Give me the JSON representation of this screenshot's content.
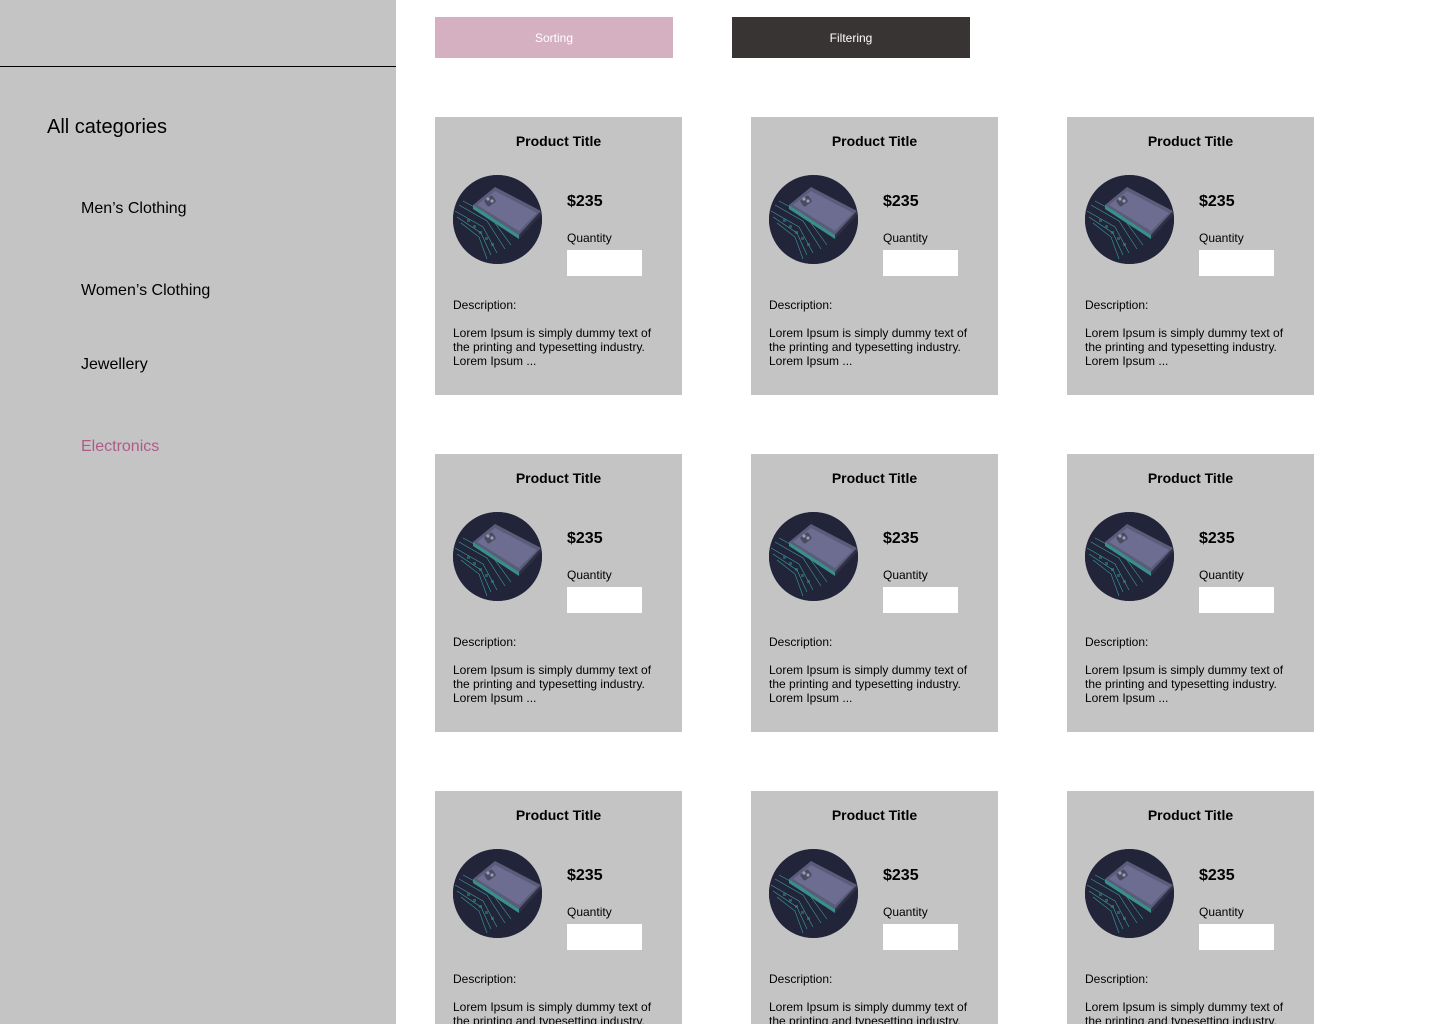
{
  "colors": {
    "accent": "#b05a88",
    "sidebar_bg": "#c4c4c4",
    "sorting_bg": "#d5b0c1",
    "filtering_bg": "#393434",
    "card_bg": "#c4c4c4"
  },
  "sidebar": {
    "title": "All categories",
    "items": [
      {
        "label": "Men’s Clothing",
        "active": false
      },
      {
        "label": "Women’s Clothing",
        "active": false
      },
      {
        "label": "Jewellery",
        "active": false
      },
      {
        "label": "Electronics",
        "active": true
      }
    ]
  },
  "toolbar": {
    "sorting_label": "Sorting",
    "filtering_label": "Filtering"
  },
  "products": [
    {
      "title": "Product Title",
      "price": "$235",
      "quantity_label": "Quantity",
      "quantity_value": "",
      "description_label": "Description:",
      "description": "Lorem Ipsum is simply dummy text of the printing and typesetting industry. Lorem Ipsum ...",
      "image_icon": "smartphone-image"
    },
    {
      "title": "Product Title",
      "price": "$235",
      "quantity_label": "Quantity",
      "quantity_value": "",
      "description_label": "Description:",
      "description": "Lorem Ipsum is simply dummy text of the printing and typesetting industry. Lorem Ipsum ...",
      "image_icon": "smartphone-image"
    },
    {
      "title": "Product Title",
      "price": "$235",
      "quantity_label": "Quantity",
      "quantity_value": "",
      "description_label": "Description:",
      "description": "Lorem Ipsum is simply dummy text of the printing and typesetting industry. Lorem Ipsum ...",
      "image_icon": "smartphone-image"
    },
    {
      "title": "Product Title",
      "price": "$235",
      "quantity_label": "Quantity",
      "quantity_value": "",
      "description_label": "Description:",
      "description": "Lorem Ipsum is simply dummy text of the printing and typesetting industry. Lorem Ipsum ...",
      "image_icon": "smartphone-image"
    },
    {
      "title": "Product Title",
      "price": "$235",
      "quantity_label": "Quantity",
      "quantity_value": "",
      "description_label": "Description:",
      "description": "Lorem Ipsum is simply dummy text of the printing and typesetting industry. Lorem Ipsum ...",
      "image_icon": "smartphone-image"
    },
    {
      "title": "Product Title",
      "price": "$235",
      "quantity_label": "Quantity",
      "quantity_value": "",
      "description_label": "Description:",
      "description": "Lorem Ipsum is simply dummy text of the printing and typesetting industry. Lorem Ipsum ...",
      "image_icon": "smartphone-image"
    },
    {
      "title": "Product Title",
      "price": "$235",
      "quantity_label": "Quantity",
      "quantity_value": "",
      "description_label": "Description:",
      "description": "Lorem Ipsum is simply dummy text of the printing and typesetting industry. Lorem Ipsum ...",
      "image_icon": "smartphone-image"
    },
    {
      "title": "Product Title",
      "price": "$235",
      "quantity_label": "Quantity",
      "quantity_value": "",
      "description_label": "Description:",
      "description": "Lorem Ipsum is simply dummy text of the printing and typesetting industry. Lorem Ipsum ...",
      "image_icon": "smartphone-image"
    },
    {
      "title": "Product Title",
      "price": "$235",
      "quantity_label": "Quantity",
      "quantity_value": "",
      "description_label": "Description:",
      "description": "Lorem Ipsum is simply dummy text of the printing and typesetting industry. Lorem Ipsum ...",
      "image_icon": "smartphone-image"
    }
  ]
}
